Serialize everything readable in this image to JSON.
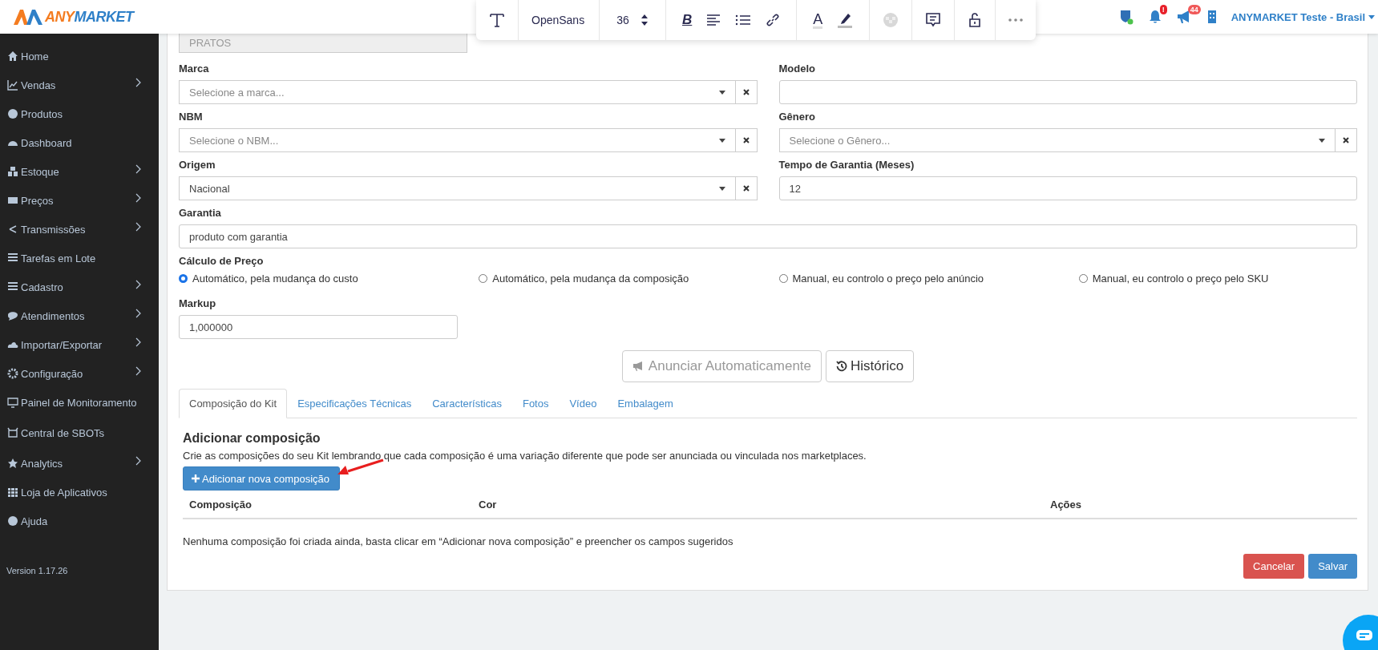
{
  "logo": {
    "parts": [
      "ANY",
      "MARKET"
    ]
  },
  "editor_toolbar": {
    "font": "OpenSans",
    "size": "36",
    "bold_label": "B",
    "color_label": "A"
  },
  "header": {
    "notifications_badge": "!",
    "announcements_badge": "44",
    "account": "ANYMARKET Teste - Brasil"
  },
  "sidebar": {
    "items": [
      {
        "label": "Home",
        "has_submenu": false
      },
      {
        "label": "Vendas",
        "has_submenu": true
      },
      {
        "label": "Produtos",
        "has_submenu": false
      },
      {
        "label": "Dashboard",
        "has_submenu": false
      },
      {
        "label": "Estoque",
        "has_submenu": true
      },
      {
        "label": "Preços",
        "has_submenu": true
      },
      {
        "label": "Transmissões",
        "has_submenu": true
      },
      {
        "label": "Tarefas em Lote",
        "has_submenu": false
      },
      {
        "label": "Cadastro",
        "has_submenu": true
      },
      {
        "label": "Atendimentos",
        "has_submenu": true
      },
      {
        "label": "Importar/Exportar",
        "has_submenu": true
      },
      {
        "label": "Configuração",
        "has_submenu": true
      },
      {
        "label": "Painel de Monitoramento",
        "has_submenu": false
      },
      {
        "label": "Central de SBOTs",
        "has_submenu": false
      },
      {
        "label": "Analytics",
        "has_submenu": true
      },
      {
        "label": "Loja de Aplicativos",
        "has_submenu": false
      },
      {
        "label": "Ajuda",
        "has_submenu": false
      }
    ],
    "version": "Version 1.17.26"
  },
  "form": {
    "top_field_value": "PRATOS",
    "fields": [
      {
        "label": "Marca",
        "kind": "select",
        "placeholder": "Selecione a marca..."
      },
      {
        "label": "Modelo",
        "kind": "text"
      },
      {
        "label": "NBM",
        "kind": "select",
        "placeholder": "Selecione o NBM..."
      },
      {
        "label": "Gênero",
        "kind": "select",
        "placeholder": "Selecione o Gênero..."
      },
      {
        "label": "Origem",
        "kind": "select",
        "value": "Nacional"
      },
      {
        "label": "Tempo de Garantia (Meses)",
        "kind": "text",
        "value": "12"
      }
    ],
    "warranty": {
      "label": "Garantia",
      "value": "produto com garantia"
    },
    "price_calc": {
      "label": "Cálculo de Preço",
      "options": [
        {
          "label": "Automático, pela mudança do custo",
          "selected": true
        },
        {
          "label": "Automático, pela mudança da composição",
          "selected": false
        },
        {
          "label": "Manual, eu controlo o preço pelo anúncio",
          "selected": false
        },
        {
          "label": "Manual, eu controlo o preço pelo SKU",
          "selected": false
        }
      ]
    },
    "markup": {
      "label": "Markup",
      "value": "1,000000"
    }
  },
  "actions": [
    {
      "label": "Anunciar Automaticamente",
      "disabled": true
    },
    {
      "label": "Histórico",
      "disabled": false
    }
  ],
  "tabs": [
    {
      "label": "Composição do Kit",
      "selected": true
    },
    {
      "label": "Especificações Técnicas",
      "selected": false
    },
    {
      "label": "Características",
      "selected": false
    },
    {
      "label": "Fotos",
      "selected": false
    },
    {
      "label": "Vídeo",
      "selected": false
    },
    {
      "label": "Embalagem",
      "selected": false
    }
  ],
  "composition": {
    "title": "Adicionar composição",
    "description": "Crie as composições do seu Kit lembrando que cada composição é uma variação diferente que pode ser anunciada ou vinculada nos marketplaces.",
    "add_button": "Adicionar nova composição",
    "columns": [
      "Composição",
      "Cor",
      "Ações"
    ],
    "empty_message": "Nenhuma composição foi criada ainda, basta clicar em “Adicionar nova composição” e preencher os campos sugeridos"
  },
  "footer_buttons": {
    "cancel": "Cancelar",
    "save": "Salvar"
  }
}
